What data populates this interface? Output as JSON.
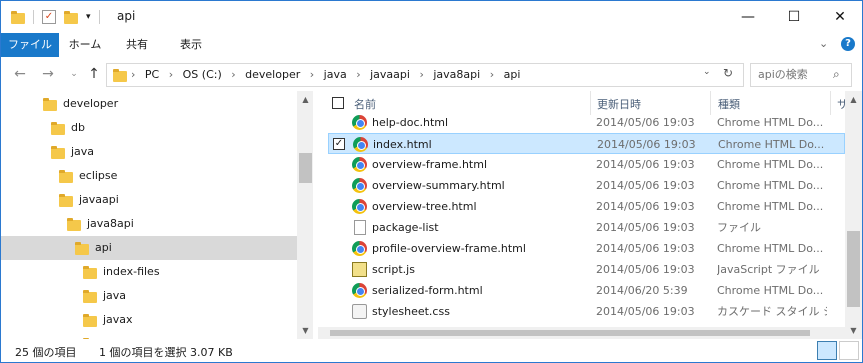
{
  "window": {
    "title": "api"
  },
  "quick_access": {
    "folder_icon": "folder-icon",
    "properties_icon": "properties-icon",
    "newfolder_icon": "new-folder-icon"
  },
  "window_controls": {
    "minimize": "—",
    "maximize": "☐",
    "close": "✕"
  },
  "ribbon": {
    "tabs": [
      "ファイル",
      "ホーム",
      "共有",
      "表示"
    ],
    "expand_icon": "chevron-down-icon",
    "help_icon": "help-icon"
  },
  "address": {
    "breadcrumbs": [
      "PC",
      "OS (C:)",
      "developer",
      "java",
      "javaapi",
      "java8api",
      "api"
    ],
    "search_placeholder": "apiの検索"
  },
  "nav_tree": [
    {
      "label": "developer",
      "level": 0
    },
    {
      "label": "db",
      "level": 1
    },
    {
      "label": "java",
      "level": 1
    },
    {
      "label": "eclipse",
      "level": 2
    },
    {
      "label": "javaapi",
      "level": 2
    },
    {
      "label": "java8api",
      "level": 3
    },
    {
      "label": "api",
      "level": 4,
      "selected": true
    },
    {
      "label": "index-files",
      "level": 5
    },
    {
      "label": "java",
      "level": 5
    },
    {
      "label": "javax",
      "level": 5
    },
    {
      "label": "",
      "level": 5
    }
  ],
  "columns": {
    "name": "名前",
    "date": "更新日時",
    "type": "種類",
    "size": "サ"
  },
  "files": [
    {
      "name": "help-doc.html",
      "date": "2014/05/06 19:03",
      "type": "Chrome HTML Do...",
      "icon": "chrome"
    },
    {
      "name": "index.html",
      "date": "2014/05/06 19:03",
      "type": "Chrome HTML Do...",
      "icon": "chrome",
      "selected": true
    },
    {
      "name": "overview-frame.html",
      "date": "2014/05/06 19:03",
      "type": "Chrome HTML Do...",
      "icon": "chrome"
    },
    {
      "name": "overview-summary.html",
      "date": "2014/05/06 19:03",
      "type": "Chrome HTML Do...",
      "icon": "chrome"
    },
    {
      "name": "overview-tree.html",
      "date": "2014/05/06 19:03",
      "type": "Chrome HTML Do...",
      "icon": "chrome"
    },
    {
      "name": "package-list",
      "date": "2014/05/06 19:03",
      "type": "ファイル",
      "icon": "doc"
    },
    {
      "name": "profile-overview-frame.html",
      "date": "2014/05/06 19:03",
      "type": "Chrome HTML Do...",
      "icon": "chrome"
    },
    {
      "name": "script.js",
      "date": "2014/05/06 19:03",
      "type": "JavaScript ファイル",
      "icon": "js"
    },
    {
      "name": "serialized-form.html",
      "date": "2014/06/20 5:39",
      "type": "Chrome HTML Do...",
      "icon": "chrome"
    },
    {
      "name": "stylesheet.css",
      "date": "2014/05/06 19:03",
      "type": "カスケード スタイル シ...",
      "icon": "css"
    }
  ],
  "status": {
    "item_count": "25 個の項目",
    "selection": "1 個の項目を選択 3.07 KB"
  },
  "colors": {
    "accent": "#1979ca",
    "selection": "#cce8ff",
    "selection_border": "#99d1ff"
  }
}
